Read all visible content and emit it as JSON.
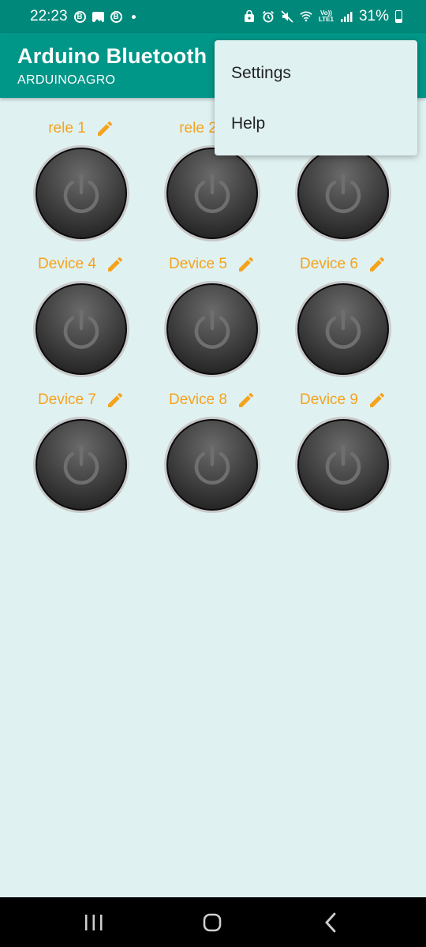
{
  "status_bar": {
    "time": "22:23",
    "left_icons": [
      "b-circle-icon",
      "image-icon",
      "b-circle-icon",
      "dot-icon"
    ],
    "right_icons": [
      "secure-folder-icon",
      "alarm-icon",
      "mute-icon",
      "wifi-icon",
      "volte-icon",
      "signal-icon"
    ],
    "volte_top": "Vo))",
    "volte_bottom": "LTE1",
    "battery_text": "31%",
    "battery_level": 0.31
  },
  "app_bar": {
    "title": "Arduino Bluetooth",
    "subtitle": "ARDUINOAGRO"
  },
  "menu": {
    "items": [
      {
        "label": "Settings"
      },
      {
        "label": "Help"
      }
    ]
  },
  "devices": [
    {
      "label": "rele 1"
    },
    {
      "label": "rele 2"
    },
    {
      "label": ""
    },
    {
      "label": "Device 4"
    },
    {
      "label": "Device 5"
    },
    {
      "label": "Device 6"
    },
    {
      "label": "Device 7"
    },
    {
      "label": "Device 8"
    },
    {
      "label": "Device 9"
    }
  ],
  "colors": {
    "status_bar": "#00897b",
    "app_bar": "#009688",
    "background": "#e0f1f2",
    "label_accent": "#f4a31c"
  },
  "nav": {
    "buttons": [
      "recent-apps-icon",
      "home-icon",
      "back-icon"
    ]
  }
}
